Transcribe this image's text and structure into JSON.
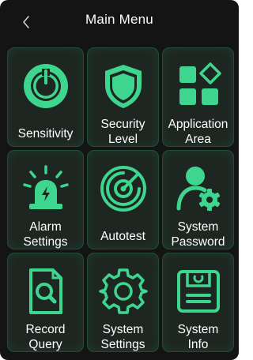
{
  "header": {
    "title": "Main Menu",
    "back_icon": "chevron-left-icon"
  },
  "colors": {
    "background": "#141414",
    "tile": "#1e2621",
    "accent": "#3ed68f",
    "text": "#ffffff"
  },
  "menu": [
    {
      "label": "Sensitivity",
      "icon": "power-dial-icon"
    },
    {
      "label": "Security\nLevel",
      "icon": "shield-icon"
    },
    {
      "label": "Application\nArea",
      "icon": "apps-grid-icon"
    },
    {
      "label": "Alarm\nSettings",
      "icon": "alarm-siren-icon"
    },
    {
      "label": "Autotest",
      "icon": "radar-icon"
    },
    {
      "label": "System\nPassword",
      "icon": "user-gear-icon"
    },
    {
      "label": "Record\nQuery",
      "icon": "document-search-icon"
    },
    {
      "label": "System\nSettings",
      "icon": "gear-icon"
    },
    {
      "label": "System\nInfo",
      "icon": "floppy-disk-icon"
    }
  ]
}
